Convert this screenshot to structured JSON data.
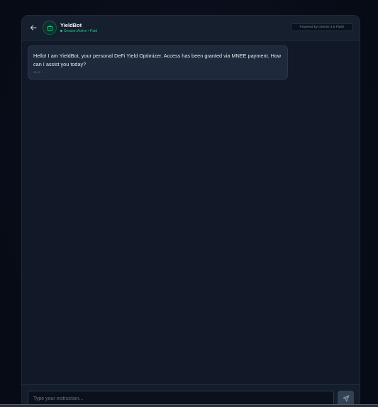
{
  "header": {
    "bot_name": "YieldBot",
    "status_text": "Session Active • Paid",
    "status_color": "#22c58e",
    "powered_by": "Powered by Gemini 2.5 Flash",
    "back_icon": "arrow-left-icon",
    "avatar_icon": "robot-icon"
  },
  "messages": [
    {
      "sender": "bot",
      "text": "Hello! I am YieldBot, your personal DeFi Yield Optimizer. Access has been granted via MNEE payment. How can I assist you today?",
      "time": "08:43"
    }
  ],
  "composer": {
    "placeholder": "Type your instruction...",
    "value": "",
    "send_icon": "send-icon"
  },
  "colors": {
    "accent": "#22c58e",
    "background": "#070b16",
    "panel": "#111827",
    "bubble": "#1e293b"
  }
}
